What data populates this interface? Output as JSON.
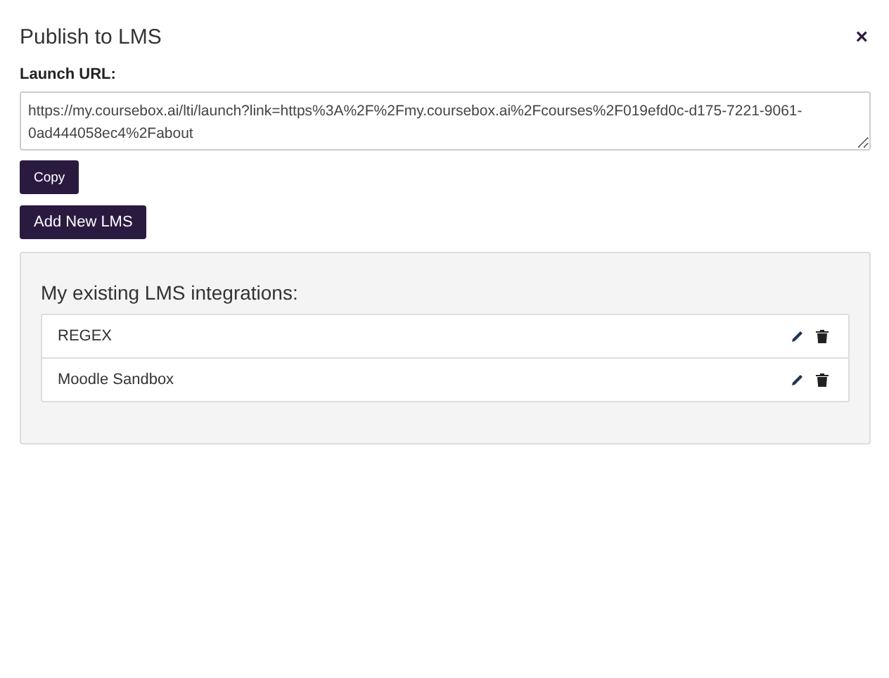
{
  "dialog": {
    "title": "Publish to LMS",
    "close": "×"
  },
  "launch_url": {
    "label": "Launch URL:",
    "value": "https://my.coursebox.ai/lti/launch?link=https%3A%2F%2Fmy.coursebox.ai%2Fcourses%2F019efd0c-d175-7221-9061-0ad444058ec4%2Fabout"
  },
  "buttons": {
    "copy": "Copy",
    "add": "Add New LMS"
  },
  "integrations": {
    "heading": "My existing LMS integrations:",
    "items": [
      {
        "name": "REGEX"
      },
      {
        "name": "Moodle Sandbox"
      }
    ]
  }
}
